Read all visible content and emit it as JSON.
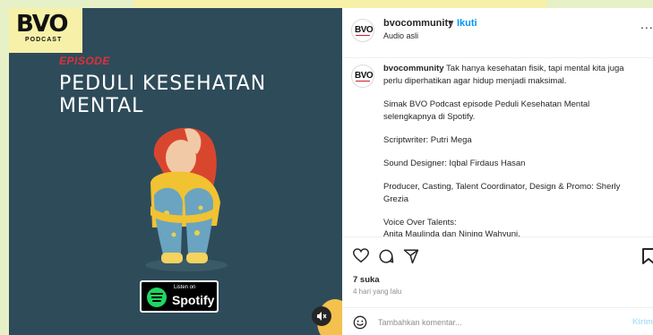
{
  "media": {
    "brand_logo": "BVO",
    "brand_sub": "PODCAST",
    "episode_label": "EPISODE",
    "episode_title": "PEDULI KESEHATAN MENTAL",
    "spotify_listen": "Listen on",
    "spotify_name": "Spotify",
    "mute_icon": "speaker-muted-icon"
  },
  "header": {
    "username": "bvocommunity",
    "separator": "•",
    "follow_label": "Ikuti",
    "audio_label": "Audio asli",
    "more_icon": "..."
  },
  "caption": {
    "username": "bvocommunity",
    "intro": " Tak hanya kesehatan fisik, tapi mental kita juga perlu diperhatikan agar hidup menjadi maksimal.",
    "line2": "Simak BVO Podcast episode Peduli Kesehatan Mental selengkapnya di Spotify.",
    "line3": "Scriptwriter: Putri Mega",
    "line4": "Sound Designer: Iqbal Firdaus Hasan",
    "line5": "Producer, Casting, Talent Coordinator, Design & Promo: Sherly Grezia",
    "line6a": "Voice Over Talents:",
    "line6b": "Anita Maulinda dan Nining Wahyuni."
  },
  "actions": {
    "likes": "7 suka",
    "time": "4 hari yang lalu"
  },
  "comment": {
    "placeholder": "Tambahkan komentar...",
    "post_label": "Kirim"
  },
  "colors": {
    "follow": "#0095f6",
    "media_bg": "#2e4b5a",
    "accent_red": "#e0303a"
  }
}
